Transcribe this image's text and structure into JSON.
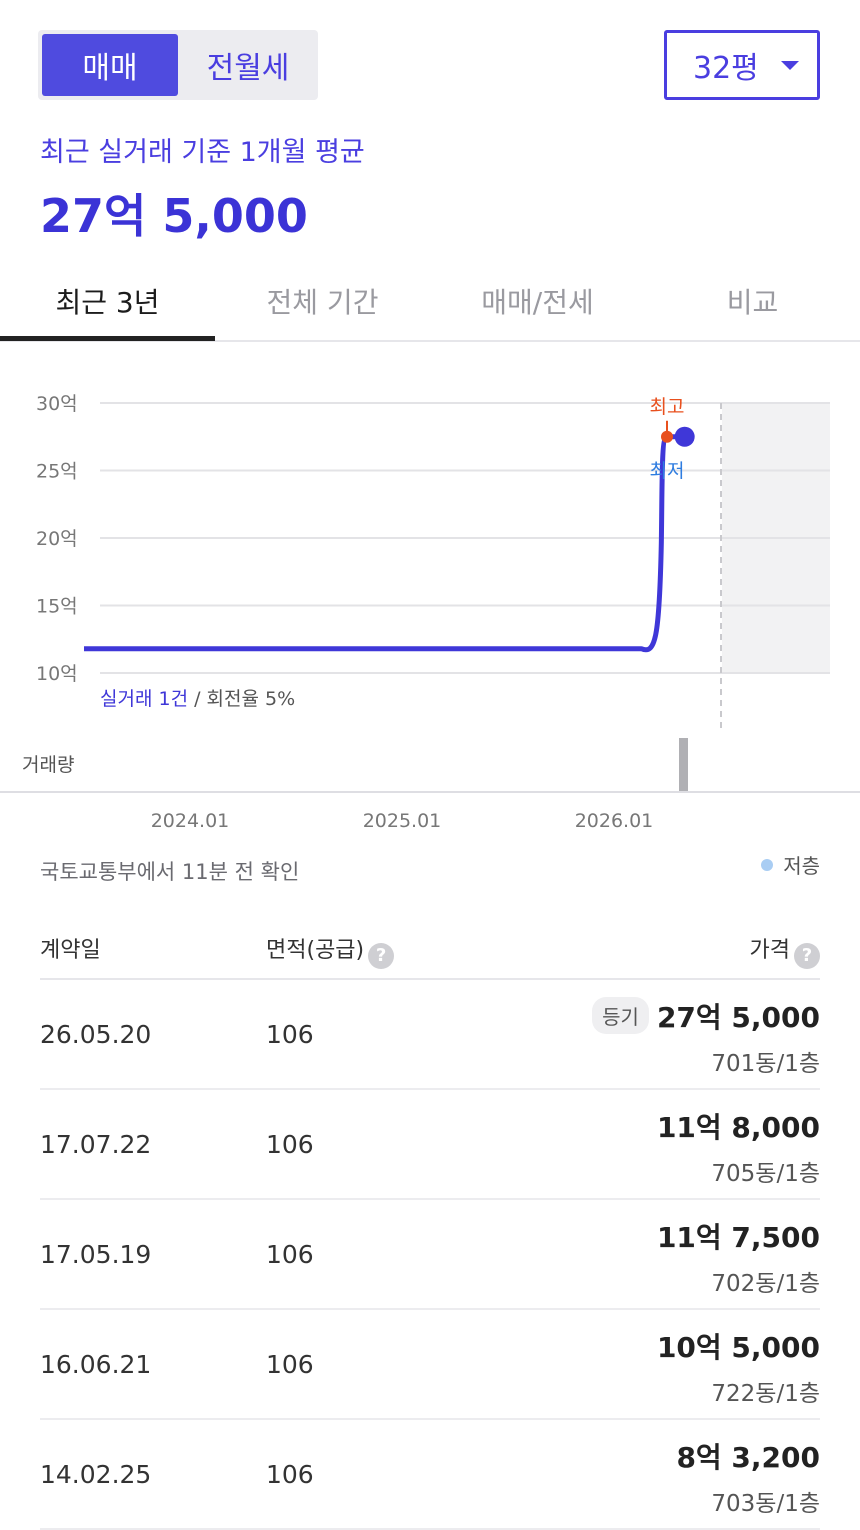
{
  "trade_toggle": {
    "sale": "매매",
    "rent": "전월세"
  },
  "size_select": {
    "value": "32평"
  },
  "summary": {
    "subtitle": "최근 실거래 기준 1개월 평균",
    "price": "27억 5,000"
  },
  "tabs": [
    {
      "label": "최근 3년"
    },
    {
      "label": "전체 기간"
    },
    {
      "label": "매매/전세"
    },
    {
      "label": "비교"
    }
  ],
  "chart_data": {
    "type": "line",
    "x_tick_labels": [
      "2024.01",
      "2025.01",
      "2026.01"
    ],
    "y_tick_labels": [
      "30억",
      "25억",
      "20억",
      "15억",
      "10억"
    ],
    "y_ticks": [
      30,
      25,
      20,
      15,
      10
    ],
    "ylim": [
      10,
      30
    ],
    "series": [
      {
        "points": [
          {
            "x": "2023.07",
            "y": 11.8
          },
          {
            "x": "2026.03",
            "y": 11.8
          },
          {
            "x": "2026.04",
            "y": 27.5
          },
          {
            "x": "2026.05",
            "y": 27.5
          }
        ]
      }
    ],
    "annotations": {
      "high": "최고",
      "low": "최저"
    },
    "volume_label": "거래량",
    "trade_count_label": "실거래 1건",
    "turnover_label": "/ 회전율 5%",
    "colors": {
      "line": "#3f37d8",
      "high": "#e8501e",
      "low": "#2f7de0",
      "volume_bar": "#b0b0b4"
    }
  },
  "source_note": "국토교통부에서 11분 전 확인",
  "legend": {
    "low_floor": "저층"
  },
  "table": {
    "headers": {
      "date": "계약일",
      "area": "면적(공급)",
      "price": "가격"
    },
    "rows": [
      {
        "date": "26.05.20",
        "area": "106",
        "badge": "등기",
        "price": "27억 5,000",
        "unit": "701동/1층"
      },
      {
        "date": "17.07.22",
        "area": "106",
        "badge": "",
        "price": "11억 8,000",
        "unit": "705동/1층"
      },
      {
        "date": "17.05.19",
        "area": "106",
        "badge": "",
        "price": "11억 7,500",
        "unit": "702동/1층"
      },
      {
        "date": "16.06.21",
        "area": "106",
        "badge": "",
        "price": "10억 5,000",
        "unit": "722동/1층"
      },
      {
        "date": "14.02.25",
        "area": "106",
        "badge": "",
        "price": "8억 3,200",
        "unit": "703동/1층"
      }
    ]
  }
}
